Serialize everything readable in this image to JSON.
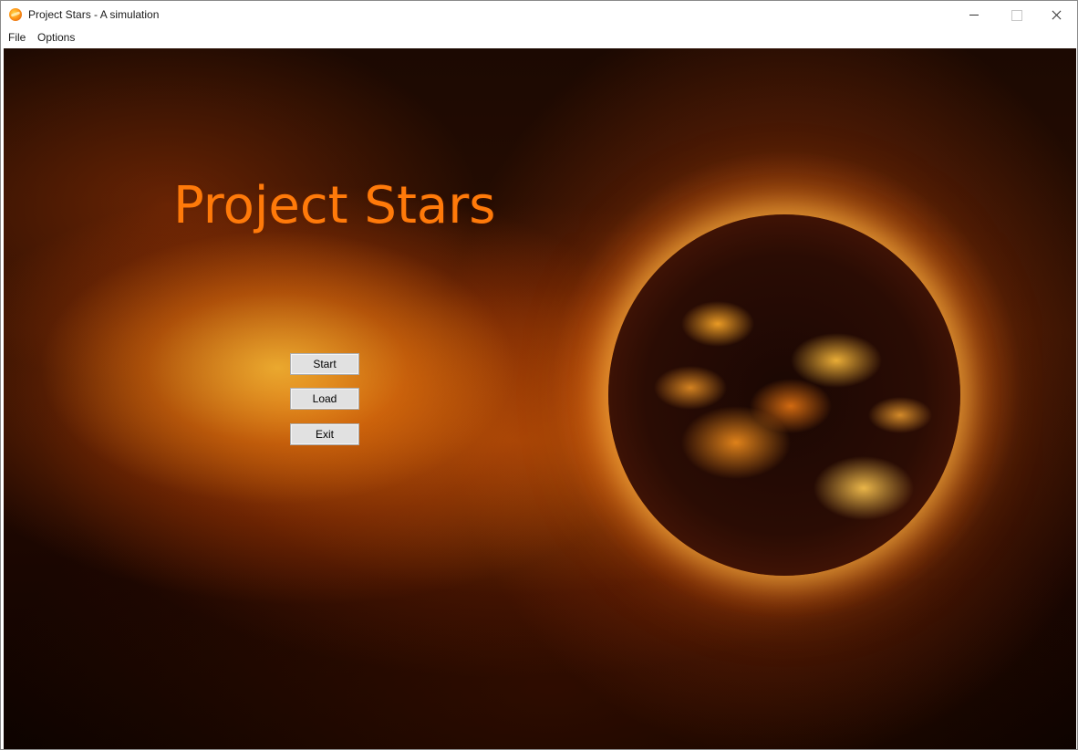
{
  "window": {
    "title": "Project Stars - A simulation",
    "icon": "sun-icon"
  },
  "menu": {
    "items": [
      "File",
      "Options"
    ]
  },
  "main": {
    "game_title": "Project Stars",
    "title_color": "#ff7a0a",
    "buttons": {
      "start": "Start",
      "load": "Load",
      "exit": "Exit"
    },
    "background": "sun-starfield-image"
  }
}
